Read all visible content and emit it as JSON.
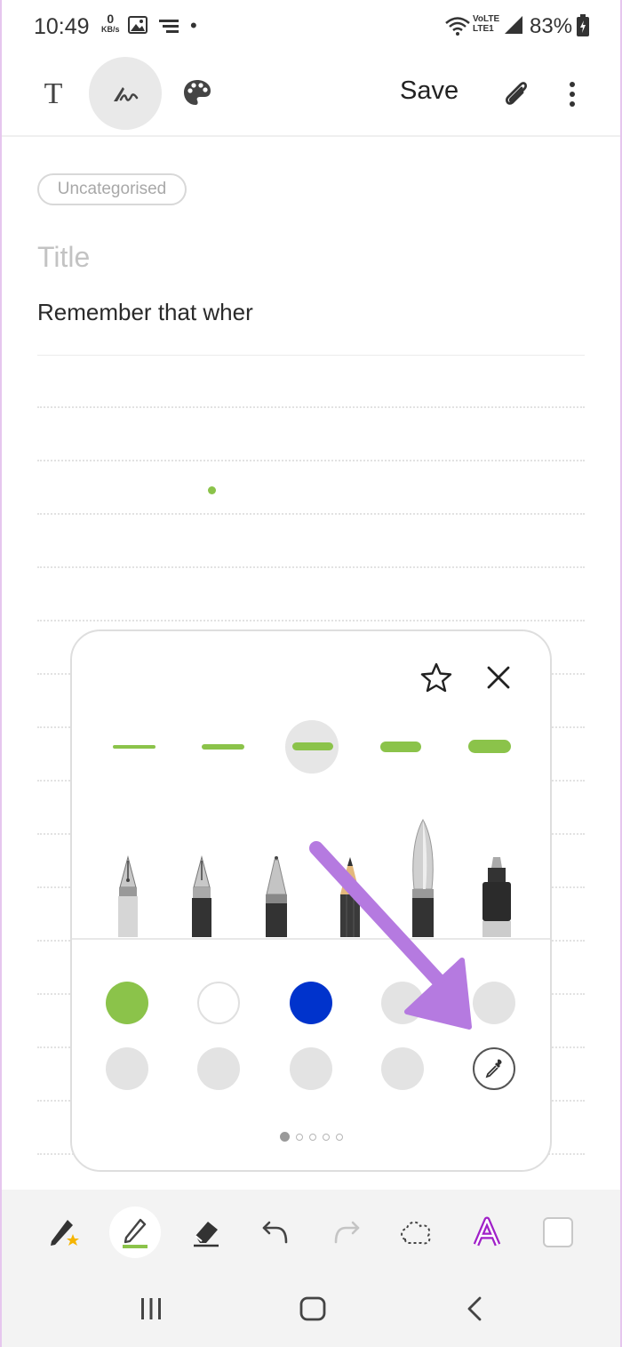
{
  "status_bar": {
    "time": "10:49",
    "net_speed_value": "0",
    "net_speed_unit": "KB/s",
    "dot": "•",
    "network_label_top": "VoLTE",
    "network_label_bottom": "LTE1",
    "battery": "83%"
  },
  "toolbar": {
    "save_label": "Save",
    "text_mode_icon": "T"
  },
  "note": {
    "category": "Uncategorised",
    "title_placeholder": "Title",
    "body": "Remember that wher"
  },
  "pen_panel": {
    "selected_stroke_index": 2,
    "colors": [
      "#8bc34a",
      "#ffffff",
      "#0033cc",
      "#e3e3e3",
      "#e3e3e3",
      "#e3e3e3",
      "#e3e3e3",
      "#e3e3e3",
      "#e3e3e3"
    ],
    "page_count": 5,
    "current_page": 1
  },
  "accent": {
    "annotation_arrow": "#b57ae0",
    "handwriting_icon": "#a020c8"
  }
}
